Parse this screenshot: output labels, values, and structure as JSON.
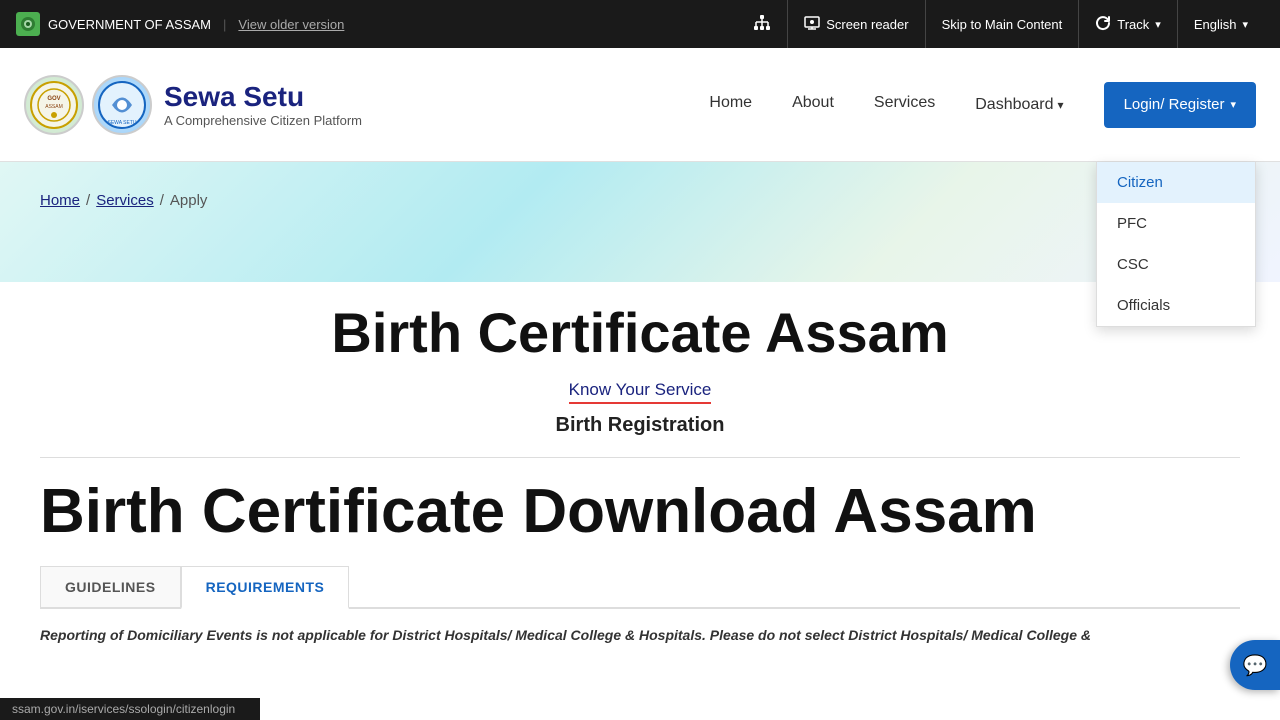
{
  "topbar": {
    "gov_title": "GOVERNMENT OF ASSAM",
    "separator": "|",
    "view_older": "View older version",
    "screen_reader_label": "Screen reader",
    "skip_label": "Skip to Main Content",
    "track_label": "Track",
    "english_label": "English",
    "org_icon": "org-chart-icon",
    "screen_icon": "screen-reader-icon",
    "track_icon": "refresh-icon",
    "caret": "▾"
  },
  "navbar": {
    "brand_name": "Sewa Setu",
    "brand_tagline": "A Comprehensive Citizen Platform",
    "nav_home": "Home",
    "nav_about": "About",
    "nav_services": "Services",
    "nav_dashboard": "Dashboard",
    "login_label": "Login/ Register",
    "caret": "▾"
  },
  "dropdown": {
    "items": [
      {
        "label": "Citizen",
        "highlighted": true
      },
      {
        "label": "PFC",
        "highlighted": false
      },
      {
        "label": "CSC",
        "highlighted": false
      },
      {
        "label": "Officials",
        "highlighted": false
      }
    ]
  },
  "breadcrumb": {
    "home": "Home",
    "services": "Services",
    "separator": "/",
    "current": "Apply"
  },
  "main": {
    "page_title": "Birth Certificate Assam",
    "know_service_link": "Know Your Service",
    "service_subtitle": "Birth Registration",
    "secondary_title": "Birth Certificate Download Assam"
  },
  "tabs": [
    {
      "label": "GUIDELINES",
      "active": false
    },
    {
      "label": "REQUIREMENTS",
      "active": true
    }
  ],
  "notice": {
    "text": "Reporting of Domiciliary Events is not applicable for District Hospitals/ Medical College & Hospitals. Please do not select District Hospitals/ Medical College &"
  },
  "statusbar": {
    "url": "ssam.gov.in/iservices/ssologin/citizenlogin"
  },
  "colors": {
    "brand_blue": "#1565c0",
    "dark_bg": "#1a1a1a",
    "link_color": "#1a237e",
    "underline_color": "#e53935"
  }
}
